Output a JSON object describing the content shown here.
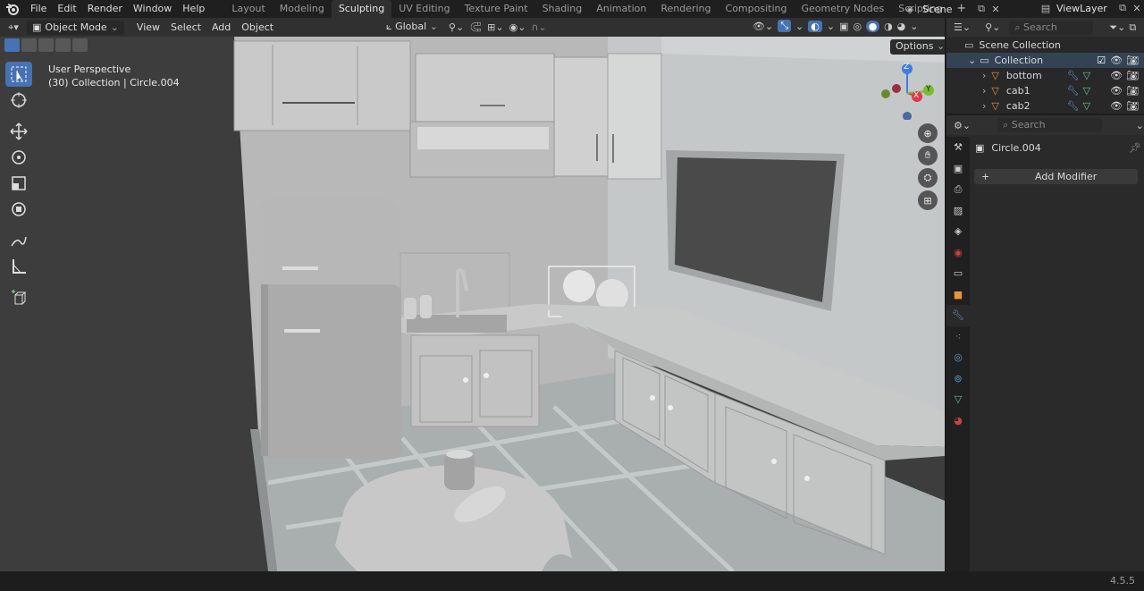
{
  "menu": [
    "File",
    "Edit",
    "Render",
    "Window",
    "Help"
  ],
  "workspaces": [
    "Layout",
    "Modeling",
    "Sculpting",
    "UV Editing",
    "Texture Paint",
    "Shading",
    "Animation",
    "Rendering",
    "Compositing",
    "Geometry Nodes",
    "Scripting"
  ],
  "active_workspace": "Sculpting",
  "scene": {
    "name": "Scene",
    "view_layer": "ViewLayer"
  },
  "viewport_header": {
    "mode": "Object Mode",
    "view": "View",
    "select": "Select",
    "add": "Add",
    "object": "Object",
    "transform_orientation": "Global",
    "options": "Options"
  },
  "viewport_overlay": {
    "perspective": "User Perspective",
    "collection_info": "(30) Collection | Circle.004"
  },
  "gizmo": {
    "x": "X",
    "y": "Y",
    "z": "Z"
  },
  "outliner": {
    "search_placeholder": "Search",
    "root": "Scene Collection",
    "collection": "Collection",
    "items": [
      "bottom",
      "cab1",
      "cab2"
    ]
  },
  "properties": {
    "search_placeholder": "Search",
    "object_name": "Circle.004",
    "add_modifier": "Add Modifier"
  },
  "version": "4.5.5",
  "colors": {
    "accent": "#4772b3",
    "x_axis": "#e0384c",
    "y_axis": "#7dba2f",
    "z_axis": "#3d7ee6",
    "mesh_icon": "#e8963a",
    "modifier_icon": "#5b9bd5",
    "data_icon": "#5fcc8f"
  }
}
